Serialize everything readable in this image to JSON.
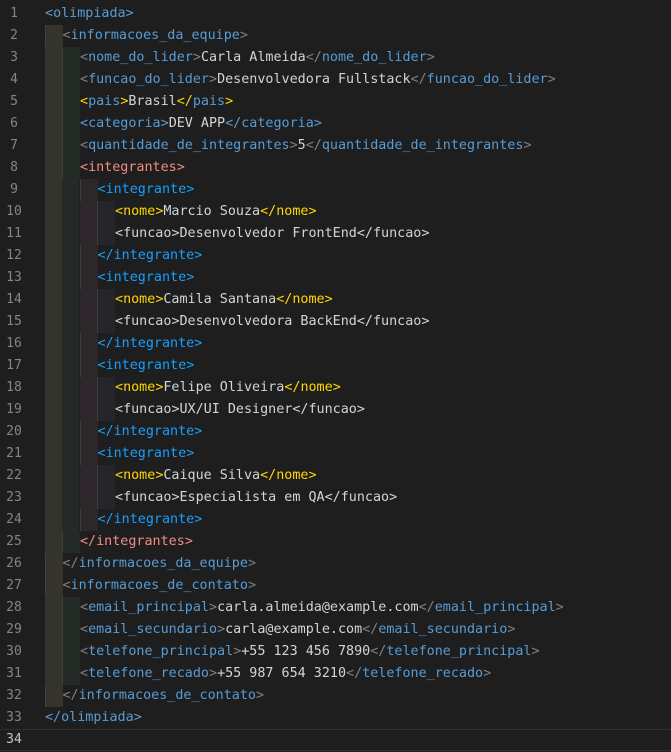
{
  "editor": {
    "language": "xml",
    "lines": [
      {
        "n": "1",
        "indent": 0,
        "tokens": [
          {
            "t": "<",
            "c": "tag"
          },
          {
            "t": "olimpiada",
            "c": "tag"
          },
          {
            "t": ">",
            "c": "tag"
          }
        ]
      },
      {
        "n": "2",
        "indent": 1,
        "tokens": [
          {
            "t": "<",
            "c": "br"
          },
          {
            "t": "informacoes_da_equipe",
            "c": "tag"
          },
          {
            "t": ">",
            "c": "br"
          }
        ]
      },
      {
        "n": "3",
        "indent": 2,
        "tokens": [
          {
            "t": "<",
            "c": "br"
          },
          {
            "t": "nome_do_lider",
            "c": "tag"
          },
          {
            "t": ">",
            "c": "br"
          },
          {
            "t": "Carla Almeida",
            "c": "txt"
          },
          {
            "t": "</",
            "c": "br"
          },
          {
            "t": "nome_do_lider",
            "c": "tag"
          },
          {
            "t": ">",
            "c": "br"
          }
        ]
      },
      {
        "n": "4",
        "indent": 2,
        "tokens": [
          {
            "t": "<",
            "c": "br"
          },
          {
            "t": "funcao_do_lider",
            "c": "tag"
          },
          {
            "t": ">",
            "c": "br"
          },
          {
            "t": "Desenvolvedora Fullstack",
            "c": "txt"
          },
          {
            "t": "</",
            "c": "br"
          },
          {
            "t": "funcao_do_lider",
            "c": "tag"
          },
          {
            "t": ">",
            "c": "br"
          }
        ]
      },
      {
        "n": "5",
        "indent": 2,
        "tokens": [
          {
            "t": "<",
            "c": "t-gold"
          },
          {
            "t": "pais",
            "c": "tag"
          },
          {
            "t": ">",
            "c": "t-gold"
          },
          {
            "t": "Brasil",
            "c": "txt"
          },
          {
            "t": "</",
            "c": "t-gold"
          },
          {
            "t": "pais",
            "c": "tag"
          },
          {
            "t": ">",
            "c": "t-gold"
          }
        ]
      },
      {
        "n": "6",
        "indent": 2,
        "tokens": [
          {
            "t": "<",
            "c": "tag"
          },
          {
            "t": "categoria",
            "c": "tag"
          },
          {
            "t": ">",
            "c": "tag"
          },
          {
            "t": "DEV APP",
            "c": "txt"
          },
          {
            "t": "</",
            "c": "tag"
          },
          {
            "t": "categoria",
            "c": "tag"
          },
          {
            "t": ">",
            "c": "tag"
          }
        ]
      },
      {
        "n": "7",
        "indent": 2,
        "tokens": [
          {
            "t": "<",
            "c": "br"
          },
          {
            "t": "quantidade_de_integrantes",
            "c": "tag"
          },
          {
            "t": ">",
            "c": "br"
          },
          {
            "t": "5",
            "c": "txt"
          },
          {
            "t": "</",
            "c": "br"
          },
          {
            "t": "quantidade_de_integrantes",
            "c": "tag"
          },
          {
            "t": ">",
            "c": "br"
          }
        ]
      },
      {
        "n": "8",
        "indent": 2,
        "tokens": [
          {
            "t": "<",
            "c": "t-pink"
          },
          {
            "t": "integrantes",
            "c": "t-pink"
          },
          {
            "t": ">",
            "c": "t-pink"
          }
        ]
      },
      {
        "n": "9",
        "indent": 3,
        "tokens": [
          {
            "t": "<",
            "c": "t-blue"
          },
          {
            "t": "integrante",
            "c": "t-blue"
          },
          {
            "t": ">",
            "c": "t-blue"
          }
        ]
      },
      {
        "n": "10",
        "indent": 4,
        "tokens": [
          {
            "t": "<",
            "c": "t-gold"
          },
          {
            "t": "nome",
            "c": "t-gold"
          },
          {
            "t": ">",
            "c": "t-gold"
          },
          {
            "t": "Marcio Souza",
            "c": "txt"
          },
          {
            "t": "</",
            "c": "t-gold"
          },
          {
            "t": "nome",
            "c": "t-gold"
          },
          {
            "t": ">",
            "c": "t-gold"
          }
        ]
      },
      {
        "n": "11",
        "indent": 4,
        "tokens": [
          {
            "t": "<",
            "c": "txt"
          },
          {
            "t": "funcao",
            "c": "txt"
          },
          {
            "t": ">",
            "c": "txt"
          },
          {
            "t": "Desenvolvedor FrontEnd",
            "c": "txt"
          },
          {
            "t": "</",
            "c": "txt"
          },
          {
            "t": "funcao",
            "c": "txt"
          },
          {
            "t": ">",
            "c": "txt"
          }
        ]
      },
      {
        "n": "12",
        "indent": 3,
        "tokens": [
          {
            "t": "</",
            "c": "t-blue"
          },
          {
            "t": "integrante",
            "c": "t-blue"
          },
          {
            "t": ">",
            "c": "t-blue"
          }
        ]
      },
      {
        "n": "13",
        "indent": 3,
        "tokens": [
          {
            "t": "<",
            "c": "t-blue"
          },
          {
            "t": "integrante",
            "c": "t-blue"
          },
          {
            "t": ">",
            "c": "t-blue"
          }
        ]
      },
      {
        "n": "14",
        "indent": 4,
        "tokens": [
          {
            "t": "<",
            "c": "t-gold"
          },
          {
            "t": "nome",
            "c": "t-gold"
          },
          {
            "t": ">",
            "c": "t-gold"
          },
          {
            "t": "Camila Santana",
            "c": "txt"
          },
          {
            "t": "</",
            "c": "t-gold"
          },
          {
            "t": "nome",
            "c": "t-gold"
          },
          {
            "t": ">",
            "c": "t-gold"
          }
        ]
      },
      {
        "n": "15",
        "indent": 4,
        "tokens": [
          {
            "t": "<",
            "c": "txt"
          },
          {
            "t": "funcao",
            "c": "txt"
          },
          {
            "t": ">",
            "c": "txt"
          },
          {
            "t": "Desenvolvedora BackEnd",
            "c": "txt"
          },
          {
            "t": "</",
            "c": "txt"
          },
          {
            "t": "funcao",
            "c": "txt"
          },
          {
            "t": ">",
            "c": "txt"
          }
        ]
      },
      {
        "n": "16",
        "indent": 3,
        "tokens": [
          {
            "t": "</",
            "c": "t-blue"
          },
          {
            "t": "integrante",
            "c": "t-blue"
          },
          {
            "t": ">",
            "c": "t-blue"
          }
        ]
      },
      {
        "n": "17",
        "indent": 3,
        "tokens": [
          {
            "t": "<",
            "c": "t-blue"
          },
          {
            "t": "integrante",
            "c": "t-blue"
          },
          {
            "t": ">",
            "c": "t-blue"
          }
        ]
      },
      {
        "n": "18",
        "indent": 4,
        "tokens": [
          {
            "t": "<",
            "c": "t-gold"
          },
          {
            "t": "nome",
            "c": "t-gold"
          },
          {
            "t": ">",
            "c": "t-gold"
          },
          {
            "t": "Felipe Oliveira",
            "c": "txt"
          },
          {
            "t": "</",
            "c": "t-gold"
          },
          {
            "t": "nome",
            "c": "t-gold"
          },
          {
            "t": ">",
            "c": "t-gold"
          }
        ]
      },
      {
        "n": "19",
        "indent": 4,
        "tokens": [
          {
            "t": "<",
            "c": "txt"
          },
          {
            "t": "funcao",
            "c": "txt"
          },
          {
            "t": ">",
            "c": "txt"
          },
          {
            "t": "UX/UI Designer",
            "c": "txt"
          },
          {
            "t": "</",
            "c": "txt"
          },
          {
            "t": "funcao",
            "c": "txt"
          },
          {
            "t": ">",
            "c": "txt"
          }
        ]
      },
      {
        "n": "20",
        "indent": 3,
        "tokens": [
          {
            "t": "</",
            "c": "t-blue"
          },
          {
            "t": "integrante",
            "c": "t-blue"
          },
          {
            "t": ">",
            "c": "t-blue"
          }
        ]
      },
      {
        "n": "21",
        "indent": 3,
        "tokens": [
          {
            "t": "<",
            "c": "t-blue"
          },
          {
            "t": "integrante",
            "c": "t-blue"
          },
          {
            "t": ">",
            "c": "t-blue"
          }
        ]
      },
      {
        "n": "22",
        "indent": 4,
        "tokens": [
          {
            "t": "<",
            "c": "t-gold"
          },
          {
            "t": "nome",
            "c": "t-gold"
          },
          {
            "t": ">",
            "c": "t-gold"
          },
          {
            "t": "Caique Silva",
            "c": "txt"
          },
          {
            "t": "</",
            "c": "t-gold"
          },
          {
            "t": "nome",
            "c": "t-gold"
          },
          {
            "t": ">",
            "c": "t-gold"
          }
        ]
      },
      {
        "n": "23",
        "indent": 4,
        "tokens": [
          {
            "t": "<",
            "c": "txt"
          },
          {
            "t": "funcao",
            "c": "txt"
          },
          {
            "t": ">",
            "c": "txt"
          },
          {
            "t": "Especialista em QA",
            "c": "txt"
          },
          {
            "t": "</",
            "c": "txt"
          },
          {
            "t": "funcao",
            "c": "txt"
          },
          {
            "t": ">",
            "c": "txt"
          }
        ]
      },
      {
        "n": "24",
        "indent": 3,
        "tokens": [
          {
            "t": "</",
            "c": "t-blue"
          },
          {
            "t": "integrante",
            "c": "t-blue"
          },
          {
            "t": ">",
            "c": "t-blue"
          }
        ]
      },
      {
        "n": "25",
        "indent": 2,
        "tokens": [
          {
            "t": "</",
            "c": "t-pink"
          },
          {
            "t": "integrantes",
            "c": "t-pink"
          },
          {
            "t": ">",
            "c": "t-pink"
          }
        ]
      },
      {
        "n": "26",
        "indent": 1,
        "tokens": [
          {
            "t": "</",
            "c": "br"
          },
          {
            "t": "informacoes_da_equipe",
            "c": "tag"
          },
          {
            "t": ">",
            "c": "br"
          }
        ]
      },
      {
        "n": "27",
        "indent": 1,
        "tokens": [
          {
            "t": "<",
            "c": "br"
          },
          {
            "t": "informacoes_de_contato",
            "c": "tag"
          },
          {
            "t": ">",
            "c": "br"
          }
        ]
      },
      {
        "n": "28",
        "indent": 2,
        "tokens": [
          {
            "t": "<",
            "c": "br"
          },
          {
            "t": "email_principal",
            "c": "tag"
          },
          {
            "t": ">",
            "c": "br"
          },
          {
            "t": "carla.almeida@example.com",
            "c": "txt"
          },
          {
            "t": "</",
            "c": "br"
          },
          {
            "t": "email_principal",
            "c": "tag"
          },
          {
            "t": ">",
            "c": "br"
          }
        ]
      },
      {
        "n": "29",
        "indent": 2,
        "tokens": [
          {
            "t": "<",
            "c": "br"
          },
          {
            "t": "email_secundario",
            "c": "tag"
          },
          {
            "t": ">",
            "c": "br"
          },
          {
            "t": "carla@example.com",
            "c": "txt"
          },
          {
            "t": "</",
            "c": "br"
          },
          {
            "t": "email_secundario",
            "c": "tag"
          },
          {
            "t": ">",
            "c": "br"
          }
        ]
      },
      {
        "n": "30",
        "indent": 2,
        "tokens": [
          {
            "t": "<",
            "c": "br"
          },
          {
            "t": "telefone_principal",
            "c": "tag"
          },
          {
            "t": ">",
            "c": "br"
          },
          {
            "t": "+55 123 456 7890",
            "c": "txt"
          },
          {
            "t": "</",
            "c": "br"
          },
          {
            "t": "telefone_principal",
            "c": "tag"
          },
          {
            "t": ">",
            "c": "br"
          }
        ]
      },
      {
        "n": "31",
        "indent": 2,
        "tokens": [
          {
            "t": "<",
            "c": "br"
          },
          {
            "t": "telefone_recado",
            "c": "tag"
          },
          {
            "t": ">",
            "c": "br"
          },
          {
            "t": "+55 987 654 3210",
            "c": "txt"
          },
          {
            "t": "</",
            "c": "br"
          },
          {
            "t": "telefone_recado",
            "c": "tag"
          },
          {
            "t": ">",
            "c": "br"
          }
        ]
      },
      {
        "n": "32",
        "indent": 1,
        "tokens": [
          {
            "t": "</",
            "c": "br"
          },
          {
            "t": "informacoes_de_contato",
            "c": "tag"
          },
          {
            "t": ">",
            "c": "br"
          }
        ]
      },
      {
        "n": "33",
        "indent": 0,
        "tokens": [
          {
            "t": "</",
            "c": "tag"
          },
          {
            "t": "olimpiada",
            "c": "tag"
          },
          {
            "t": ">",
            "c": "tag"
          }
        ]
      },
      {
        "n": "34",
        "indent": 0,
        "tokens": [],
        "current": true
      }
    ],
    "colors": {
      "background": "#1e1e1e",
      "line_number": "#858585",
      "tag": "#569cd6",
      "bracket_dim": "#808080",
      "text": "#d4d4d4",
      "bracket_gold": "#ffd700",
      "bracket_pink": "#f28b82",
      "bracket_blue": "#179fff"
    }
  }
}
